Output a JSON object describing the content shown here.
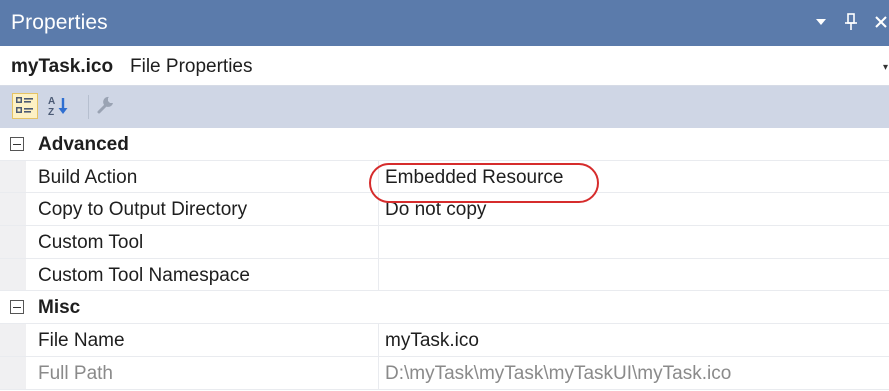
{
  "window": {
    "title": "Properties",
    "controls": [
      {
        "name": "dropdown-icon",
        "glyph": "▼"
      },
      {
        "name": "pin-icon",
        "glyph": "⊥"
      },
      {
        "name": "close-icon",
        "glyph": "✕"
      }
    ]
  },
  "object": {
    "name": "myTask.ico",
    "type": "File Properties"
  },
  "toolbar": {
    "buttons": [
      {
        "name": "categorized-icon",
        "active": true
      },
      {
        "name": "alphabetical-icon",
        "active": false
      },
      {
        "name": "property-pages-icon",
        "active": false
      }
    ]
  },
  "grid": {
    "categories": [
      {
        "name": "Advanced",
        "expanded": true,
        "properties": [
          {
            "name": "Build Action",
            "value": "Embedded Resource",
            "highlighted": true
          },
          {
            "name": "Copy to Output Directory",
            "value": "Do not copy"
          },
          {
            "name": "Custom Tool",
            "value": ""
          },
          {
            "name": "Custom Tool Namespace",
            "value": ""
          }
        ]
      },
      {
        "name": "Misc",
        "expanded": true,
        "properties": [
          {
            "name": "File Name",
            "value": "myTask.ico"
          },
          {
            "name": "Full Path",
            "value": "D:\\myTask\\myTask\\myTaskUI\\myTask.ico",
            "readonly": true
          }
        ]
      }
    ]
  },
  "colors": {
    "title_bar": "#5b7bab",
    "toolbar": "#cfd6e5",
    "highlight_ring": "#d62c2c"
  }
}
